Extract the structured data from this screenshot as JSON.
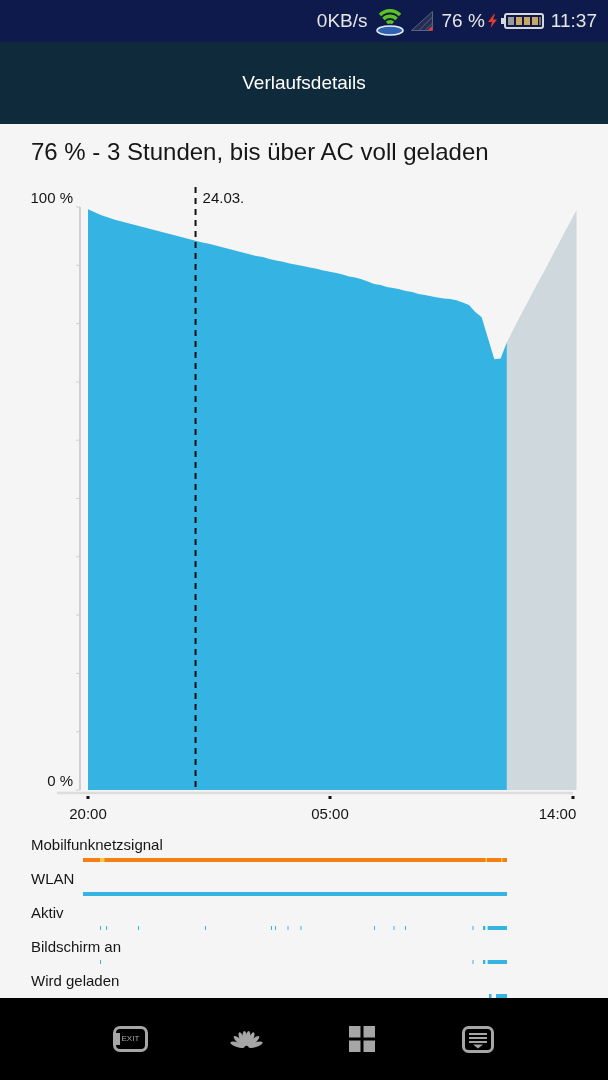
{
  "status_bar": {
    "network_speed": "0KB/s",
    "battery_percent": "76 %",
    "charging": true,
    "time": "11:37"
  },
  "header": {
    "title": "Verlaufsdetails"
  },
  "summary": "76 % - 3 Stunden, bis über AC voll geladen",
  "battery_chart": {
    "chart_data": {
      "type": "area",
      "categories": [
        "20:00",
        null,
        null,
        null,
        null,
        null,
        null,
        null,
        null,
        null,
        null,
        null,
        null,
        null,
        null,
        null,
        null,
        null,
        null,
        null,
        null,
        null,
        null,
        null,
        null,
        null,
        null,
        null,
        null,
        null,
        null,
        null,
        null,
        null,
        null,
        null,
        "05:00",
        null,
        null,
        null,
        null,
        null,
        null,
        null,
        null,
        null,
        null,
        null,
        null,
        null,
        null,
        null,
        null,
        null,
        null,
        null,
        null,
        null,
        null,
        null,
        null,
        null,
        null,
        null,
        null,
        null,
        null,
        null,
        null,
        null,
        null,
        null,
        "14:00",
        null,
        null,
        null
      ],
      "series": [
        {
          "color": "#35b4e4",
          "values": [
            99.6,
            99.1,
            98.6,
            98.2,
            97.8,
            97.5,
            97.2,
            96.9,
            96.6,
            96.3,
            96.0,
            95.7,
            95.4,
            95.1,
            94.8,
            94.5,
            94.2,
            93.9,
            93.7,
            93.4,
            93.1,
            92.8,
            92.5,
            92.2,
            91.9,
            91.6,
            91.4,
            91.1,
            90.8,
            90.6,
            90.3,
            90.1,
            89.9,
            89.6,
            89.4,
            89.1,
            88.9,
            88.7,
            88.4,
            88.1,
            87.9,
            87.6,
            87.2,
            86.8,
            86.6,
            86.3,
            86.1,
            85.9,
            85.6,
            85.4,
            85.1,
            84.9,
            84.7,
            84.5,
            84.3,
            84.2,
            84.0,
            83.6,
            83.2,
            82.0,
            81.1,
            77.5,
            73.9,
            74.0,
            76.8,
            null,
            null,
            null,
            null,
            null,
            null,
            null,
            null,
            null,
            null,
            null
          ]
        },
        {
          "color": "#cfd8dd",
          "values": [
            null,
            null,
            null,
            null,
            null,
            null,
            null,
            null,
            null,
            null,
            null,
            null,
            null,
            null,
            null,
            null,
            null,
            null,
            null,
            null,
            null,
            null,
            null,
            null,
            null,
            null,
            null,
            null,
            null,
            null,
            null,
            null,
            null,
            null,
            null,
            null,
            null,
            null,
            null,
            null,
            null,
            null,
            null,
            null,
            null,
            null,
            null,
            null,
            null,
            null,
            null,
            null,
            null,
            null,
            null,
            null,
            null,
            null,
            null,
            null,
            null,
            null,
            null,
            null,
            76.8,
            79.0,
            81.1,
            83.1,
            85.2,
            87.2,
            89.2,
            91.3,
            93.3,
            95.4,
            97.4,
            99.5
          ]
        }
      ],
      "ylim": [
        0,
        100
      ],
      "yticks": [
        {
          "value": 0,
          "label": "0 %"
        },
        {
          "value": 100,
          "label": "100 %"
        }
      ],
      "annotations": [
        "24.03."
      ]
    }
  },
  "timelines": [
    {
      "label": "Mobilfunknetzsignal",
      "color": "#f57f12"
    },
    {
      "label": "WLAN",
      "color": "#35b4e4"
    },
    {
      "label": "Aktiv",
      "color": "#35b4e4"
    },
    {
      "label": "Bildschirm an",
      "color": "#35b4e4"
    },
    {
      "label": "Wird geladen",
      "color": "#35b4e4"
    }
  ],
  "nav_bar": {
    "items": [
      {
        "kind": "exit",
        "label": "EXIT"
      },
      {
        "kind": "logo"
      },
      {
        "kind": "apps"
      },
      {
        "kind": "panel"
      }
    ]
  }
}
